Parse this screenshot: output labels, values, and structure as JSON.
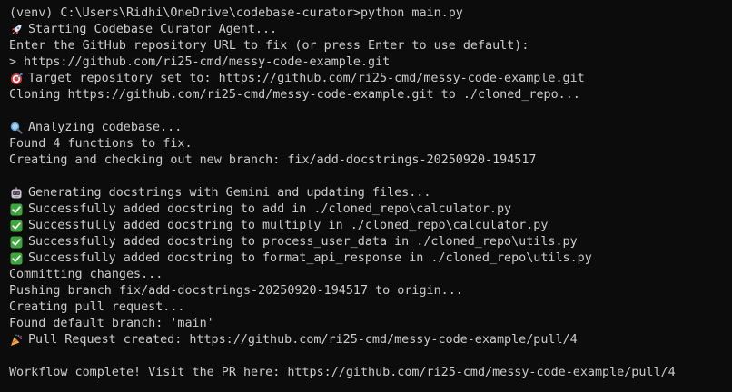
{
  "terminal": {
    "lines": {
      "l0": "(venv) C:\\Users\\Ridhi\\OneDrive\\codebase-curator>python main.py",
      "l1": "Starting Codebase Curator Agent...",
      "l2": "Enter the GitHub repository URL to fix (or press Enter to use default):",
      "l3": "> https://github.com/ri25-cmd/messy-code-example.git",
      "l4": "Target repository set to: https://github.com/ri25-cmd/messy-code-example.git",
      "l5": "Cloning https://github.com/ri25-cmd/messy-code-example.git to ./cloned_repo...",
      "l7": "Analyzing codebase...",
      "l8": "Found 4 functions to fix.",
      "l9": "Creating and checking out new branch: fix/add-docstrings-20250920-194517",
      "l11": "Generating docstrings with Gemini and updating files...",
      "l12": "Successfully added docstring to add in ./cloned_repo\\calculator.py",
      "l13": "Successfully added docstring to multiply in ./cloned_repo\\calculator.py",
      "l14": "Successfully added docstring to process_user_data in ./cloned_repo\\utils.py",
      "l15": "Successfully added docstring to format_api_response in ./cloned_repo\\utils.py",
      "l16": "Committing changes...",
      "l17": "Pushing branch fix/add-docstrings-20250920-194517 to origin...",
      "l18": "Creating pull request...",
      "l19": "Found default branch: 'main'",
      "l20": "Pull Request created: https://github.com/ri25-cmd/messy-code-example/pull/4",
      "l22": "Workflow complete! Visit the PR here: https://github.com/ri25-cmd/messy-code-example/pull/4"
    },
    "icons": {
      "l1": "rocket-icon",
      "l4": "target-icon",
      "l7": "magnifier-icon",
      "l11": "robot-icon",
      "l12": "check-icon",
      "l13": "check-icon",
      "l14": "check-icon",
      "l15": "check-icon",
      "l20": "party-popper-icon"
    },
    "colors": {
      "background": "#0c0c0c",
      "text": "#cccccc",
      "check": "#3fa63f"
    }
  }
}
